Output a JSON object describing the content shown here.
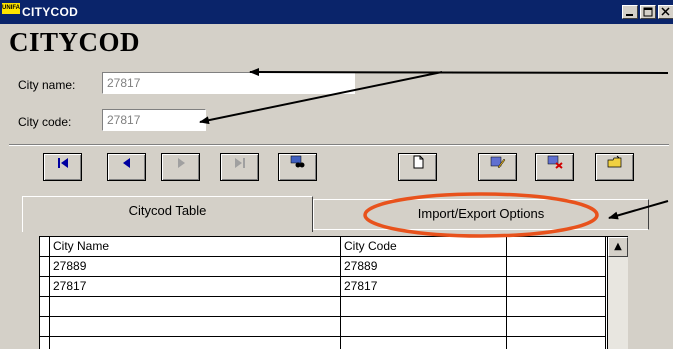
{
  "window": {
    "title": "CITYCOD",
    "app_icon_text": "UNIFACE",
    "controls": [
      "minimize-icon",
      "maximize-icon",
      "close-icon"
    ]
  },
  "form": {
    "heading": "CITYCOD",
    "city_name_label": "City name:",
    "city_name_value": "27817",
    "city_code_label": "City code:",
    "city_code_value": "27817"
  },
  "toolbar": {
    "nav_icons": [
      "first-record-icon",
      "previous-record-icon",
      "next-record-icon",
      "last-record-icon",
      "search-icon"
    ],
    "action_icons": [
      "new-record-icon",
      "edit-record-icon",
      "delete-record-icon",
      "open-folder-icon"
    ]
  },
  "tabs": [
    {
      "label": "Citycod Table",
      "active": true
    },
    {
      "label": "Import/Export Options",
      "active": false
    }
  ],
  "table": {
    "columns": [
      "City Name",
      "City Code",
      ""
    ],
    "rows": [
      [
        "27889",
        "27889",
        ""
      ],
      [
        "27817",
        "27817",
        ""
      ],
      [
        "",
        "",
        ""
      ],
      [
        "",
        "",
        ""
      ],
      [
        "",
        "",
        ""
      ]
    ]
  },
  "annotations": {
    "arrow_color": "#000000",
    "highlight_color": "#e8521c",
    "highlight_target": "Import/Export Options"
  }
}
